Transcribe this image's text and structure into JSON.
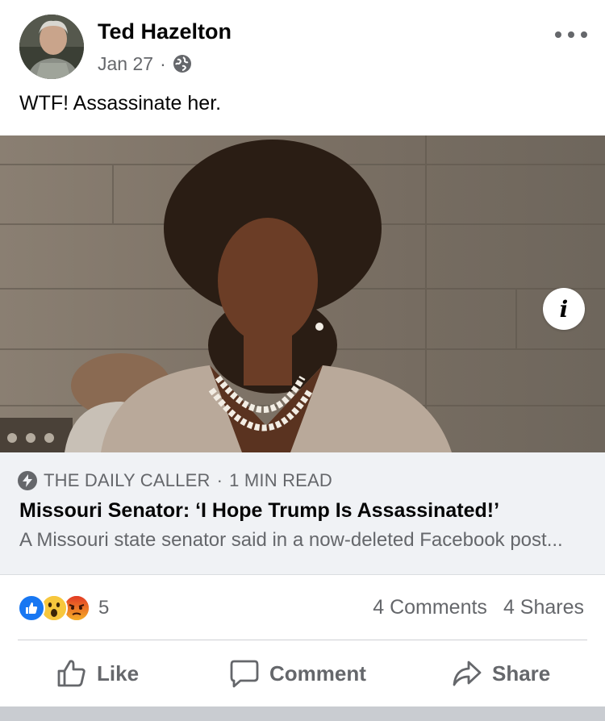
{
  "post": {
    "author": "Ted Hazelton",
    "date": "Jan 27",
    "separator": "·",
    "audience_icon": "globe-icon",
    "text": "WTF! Assassinate her."
  },
  "link": {
    "source": "THE DAILY CALLER",
    "read_time": "1 MIN READ",
    "source_separator": "·",
    "title": "Missouri Senator: ‘I Hope Trump Is Assassinated!’",
    "description": "A Missouri state senator said in a now-deleted Facebook post...",
    "info_label": "i"
  },
  "engagement": {
    "reaction_types": [
      "like",
      "wow",
      "angry"
    ],
    "reaction_count": "5",
    "comments": "4 Comments",
    "shares": "4 Shares"
  },
  "actions": {
    "like": "Like",
    "comment": "Comment",
    "share": "Share"
  },
  "colors": {
    "text_primary": "#050505",
    "text_secondary": "#65676b",
    "link_bg": "#f0f2f5",
    "like_blue": "#1877f2"
  }
}
